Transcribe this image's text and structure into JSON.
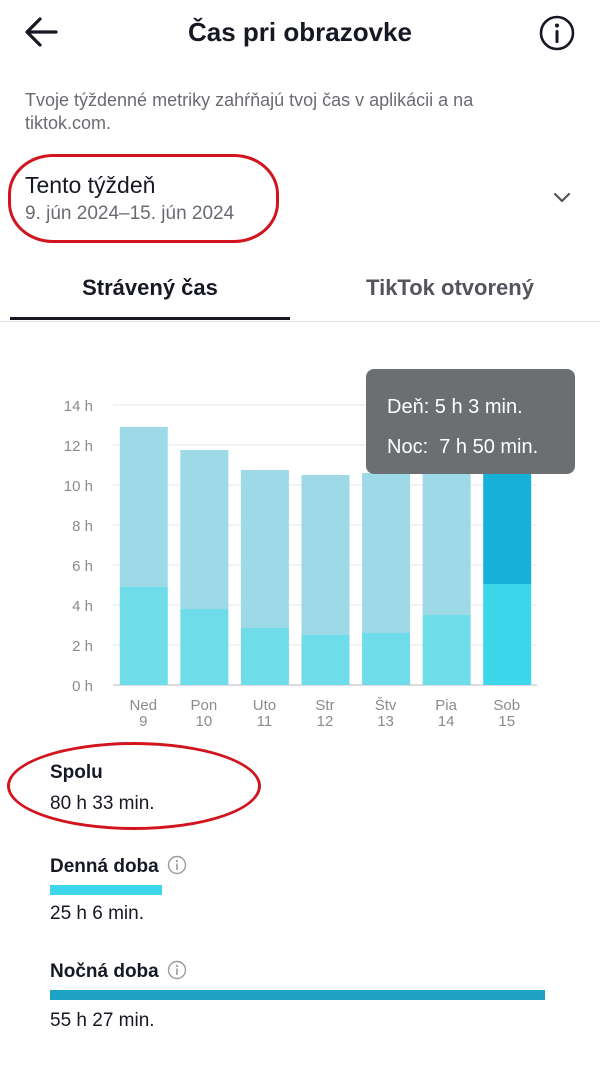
{
  "header": {
    "title": "Čas pri obrazovke",
    "back_icon": "arrow-left-icon",
    "info_icon": "info-circle-icon"
  },
  "description": "Tvoje týždenné metriky zahŕňajú tvoj čas v aplikácii a na tiktok.com.",
  "week": {
    "label": "Tento týždeň",
    "range": "9. jún 2024–15. jún 2024",
    "chevron_icon": "chevron-down-icon"
  },
  "tabs": [
    {
      "label": "Strávený čas",
      "active": true
    },
    {
      "label": "TikTok otvorený",
      "active": false
    }
  ],
  "tooltip": {
    "day": "Deň: 5 h 3 min.",
    "night": "Noc:  7 h 50 min."
  },
  "chart_data": {
    "type": "bar",
    "stacked": true,
    "y_unit": "h",
    "ylim": [
      0,
      14
    ],
    "y_ticks": [
      "0 h",
      "2 h",
      "4 h",
      "6 h",
      "8 h",
      "10 h",
      "12 h",
      "14 h"
    ],
    "categories": [
      {
        "day": "Ned",
        "date": "9"
      },
      {
        "day": "Pon",
        "date": "10"
      },
      {
        "day": "Uto",
        "date": "11"
      },
      {
        "day": "Str",
        "date": "12"
      },
      {
        "day": "Štv",
        "date": "13"
      },
      {
        "day": "Pia",
        "date": "14"
      },
      {
        "day": "Sob",
        "date": "15"
      }
    ],
    "series": [
      {
        "key": "day",
        "values": [
          4.9,
          3.8,
          2.85,
          2.5,
          2.6,
          3.5,
          5.05
        ]
      },
      {
        "key": "night",
        "values": [
          8.0,
          7.95,
          7.9,
          8.0,
          8.0,
          9.3,
          7.83
        ]
      }
    ],
    "selected_index": 6,
    "colors": {
      "day": "#6fdcea",
      "night": "#9ed9e8",
      "day_selected": "#3dd6ea",
      "night_selected": "#16b0d8",
      "grid": "#e6e7ea",
      "axis_text": "#8a8b91"
    }
  },
  "summary": {
    "total_label": "Spolu",
    "total_value": "80 h 33 min.",
    "day_label": "Denná doba",
    "day_value": "25 h 6 min.",
    "night_label": "Nočná doba",
    "night_value": "55 h 27 min.",
    "day_color": "#3dd6ea",
    "night_color": "#1ea3c4"
  }
}
